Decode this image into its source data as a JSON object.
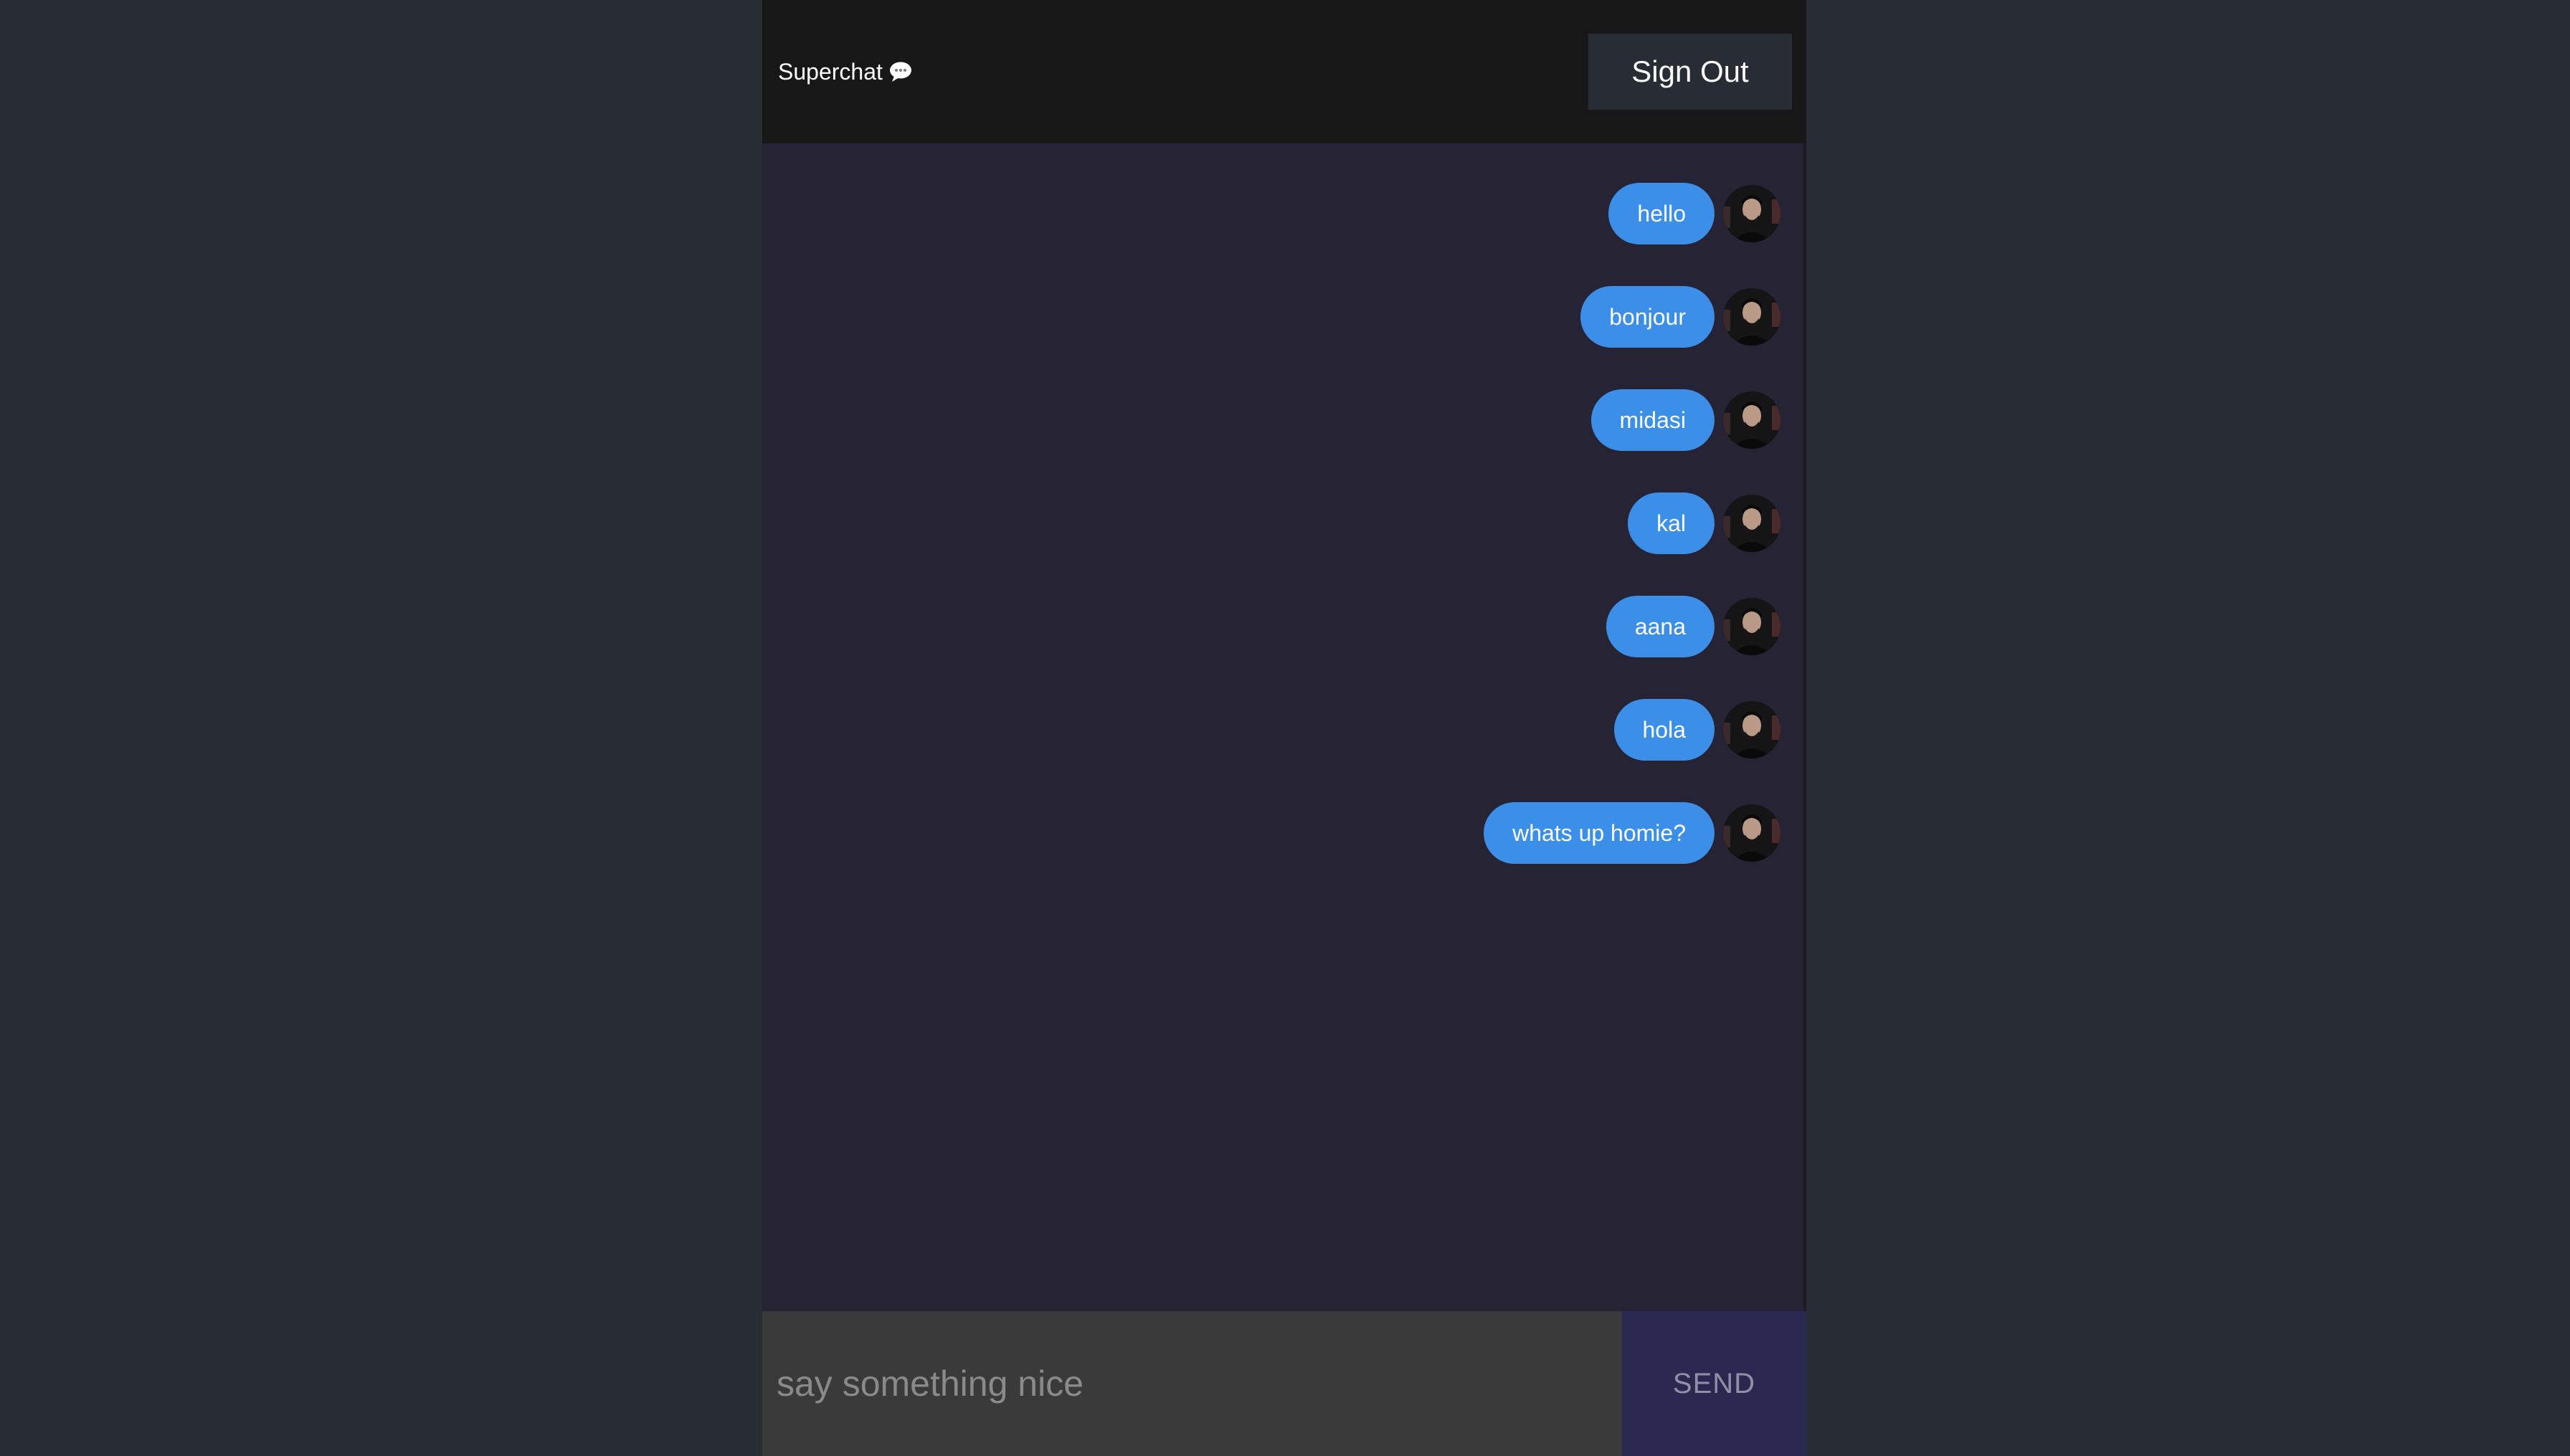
{
  "header": {
    "app_title": "Superchat",
    "title_icon": "speech-bubble-icon",
    "signout_label": "Sign Out"
  },
  "messages": [
    {
      "text": "hello",
      "avatar": "user-avatar"
    },
    {
      "text": "bonjour",
      "avatar": "user-avatar"
    },
    {
      "text": "midasi",
      "avatar": "user-avatar"
    },
    {
      "text": "kal",
      "avatar": "user-avatar"
    },
    {
      "text": "aana",
      "avatar": "user-avatar"
    },
    {
      "text": "hola",
      "avatar": "user-avatar"
    },
    {
      "text": "whats up homie?",
      "avatar": "user-avatar"
    }
  ],
  "composer": {
    "placeholder": "say something nice",
    "value": "",
    "send_label": "SEND"
  },
  "colors": {
    "page_background": "#282c34",
    "header_background": "#181717",
    "messages_background": "#262434",
    "bubble_sent": "#3b8fe8",
    "input_background": "#3a3a3a",
    "send_background": "#2a2850"
  }
}
